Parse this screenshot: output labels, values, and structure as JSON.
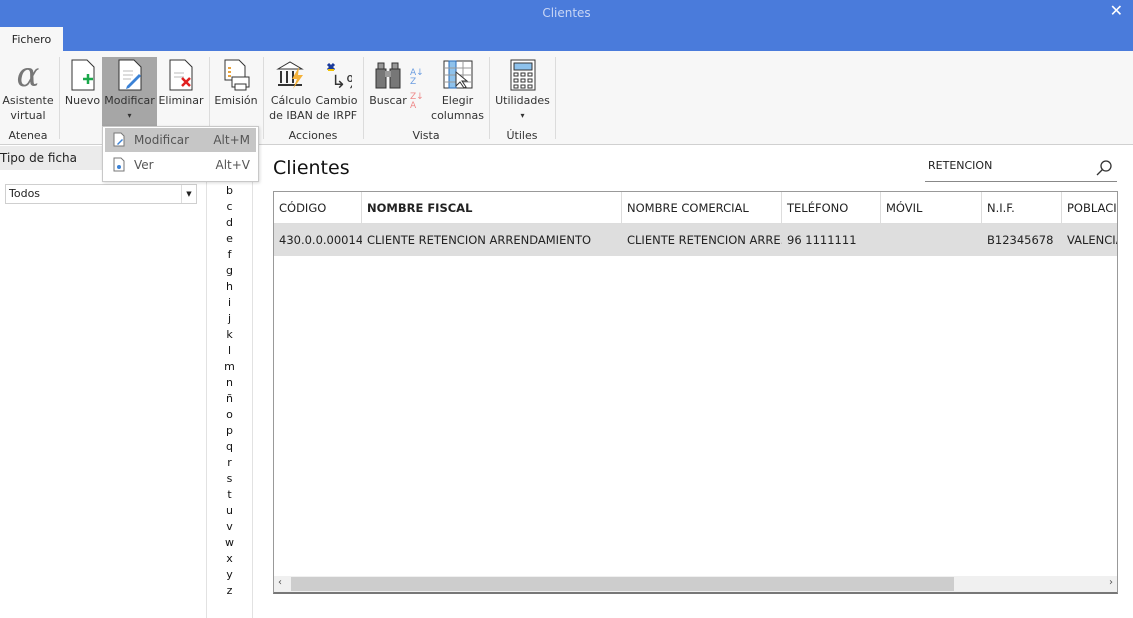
{
  "window": {
    "title": "Clientes",
    "close": "✕"
  },
  "tabs": [
    {
      "label": "Fichero"
    }
  ],
  "ribbon": {
    "buttons": [
      {
        "id": "asistente",
        "label1": "Asistente",
        "label2": "virtual",
        "icon": "alpha-icon"
      },
      {
        "id": "nuevo",
        "label1": "Nuevo",
        "icon": "new-document-icon"
      },
      {
        "id": "modificar",
        "label1": "Modificar",
        "icon": "edit-document-icon",
        "dropdown": "▾"
      },
      {
        "id": "eliminar",
        "label1": "Eliminar",
        "icon": "delete-document-icon"
      },
      {
        "id": "emision",
        "label1": "Emisión",
        "icon": "print-document-icon"
      },
      {
        "id": "iban",
        "label1": "Cálculo",
        "label2": "de IBAN",
        "icon": "bank-icon"
      },
      {
        "id": "irpf",
        "label1": "Cambio",
        "label2": "de IRPF",
        "icon": "percent-icon"
      },
      {
        "id": "buscar",
        "label1": "Buscar",
        "icon": "binoculars-icon"
      },
      {
        "id": "elegir",
        "label1": "Elegir",
        "label2": "columnas",
        "icon": "columns-icon"
      },
      {
        "id": "utilidades",
        "label1": "Utilidades",
        "icon": "calculator-icon",
        "dropdown": "▾"
      }
    ],
    "groups": [
      "Atenea",
      "Acciones",
      "Vista",
      "Útiles"
    ]
  },
  "dropdown_menu": [
    {
      "label": "Modificar",
      "shortcut": "Alt+M",
      "icon": "edit-icon"
    },
    {
      "label": "Ver",
      "shortcut": "Alt+V",
      "icon": "view-icon"
    }
  ],
  "left": {
    "header": "Tipo de ficha",
    "select_value": "Todos",
    "letters": [
      "b",
      "c",
      "d",
      "e",
      "f",
      "g",
      "h",
      "i",
      "j",
      "k",
      "l",
      "m",
      "n",
      "ñ",
      "o",
      "p",
      "q",
      "r",
      "s",
      "t",
      "u",
      "v",
      "w",
      "x",
      "y",
      "z"
    ]
  },
  "main": {
    "title": "Clientes",
    "search_value": "RETENCION"
  },
  "table": {
    "columns": [
      "CÓDIGO",
      "NOMBRE FISCAL",
      "NOMBRE COMERCIAL",
      "TELÉFONO",
      "MÓVIL",
      "N.I.F.",
      "POBLACIÓN"
    ],
    "rows": [
      [
        "430.0.0.00014",
        "CLIENTE RETENCION ARRENDAMIENTO",
        "CLIENTE RETENCION ARRE...",
        "96 1111111",
        "",
        "B12345678",
        "VALENCIA"
      ]
    ]
  },
  "colors": {
    "titlebar": "#4a7bdb",
    "selected_row": "#dedede",
    "active_button": "#a6a6a6"
  }
}
